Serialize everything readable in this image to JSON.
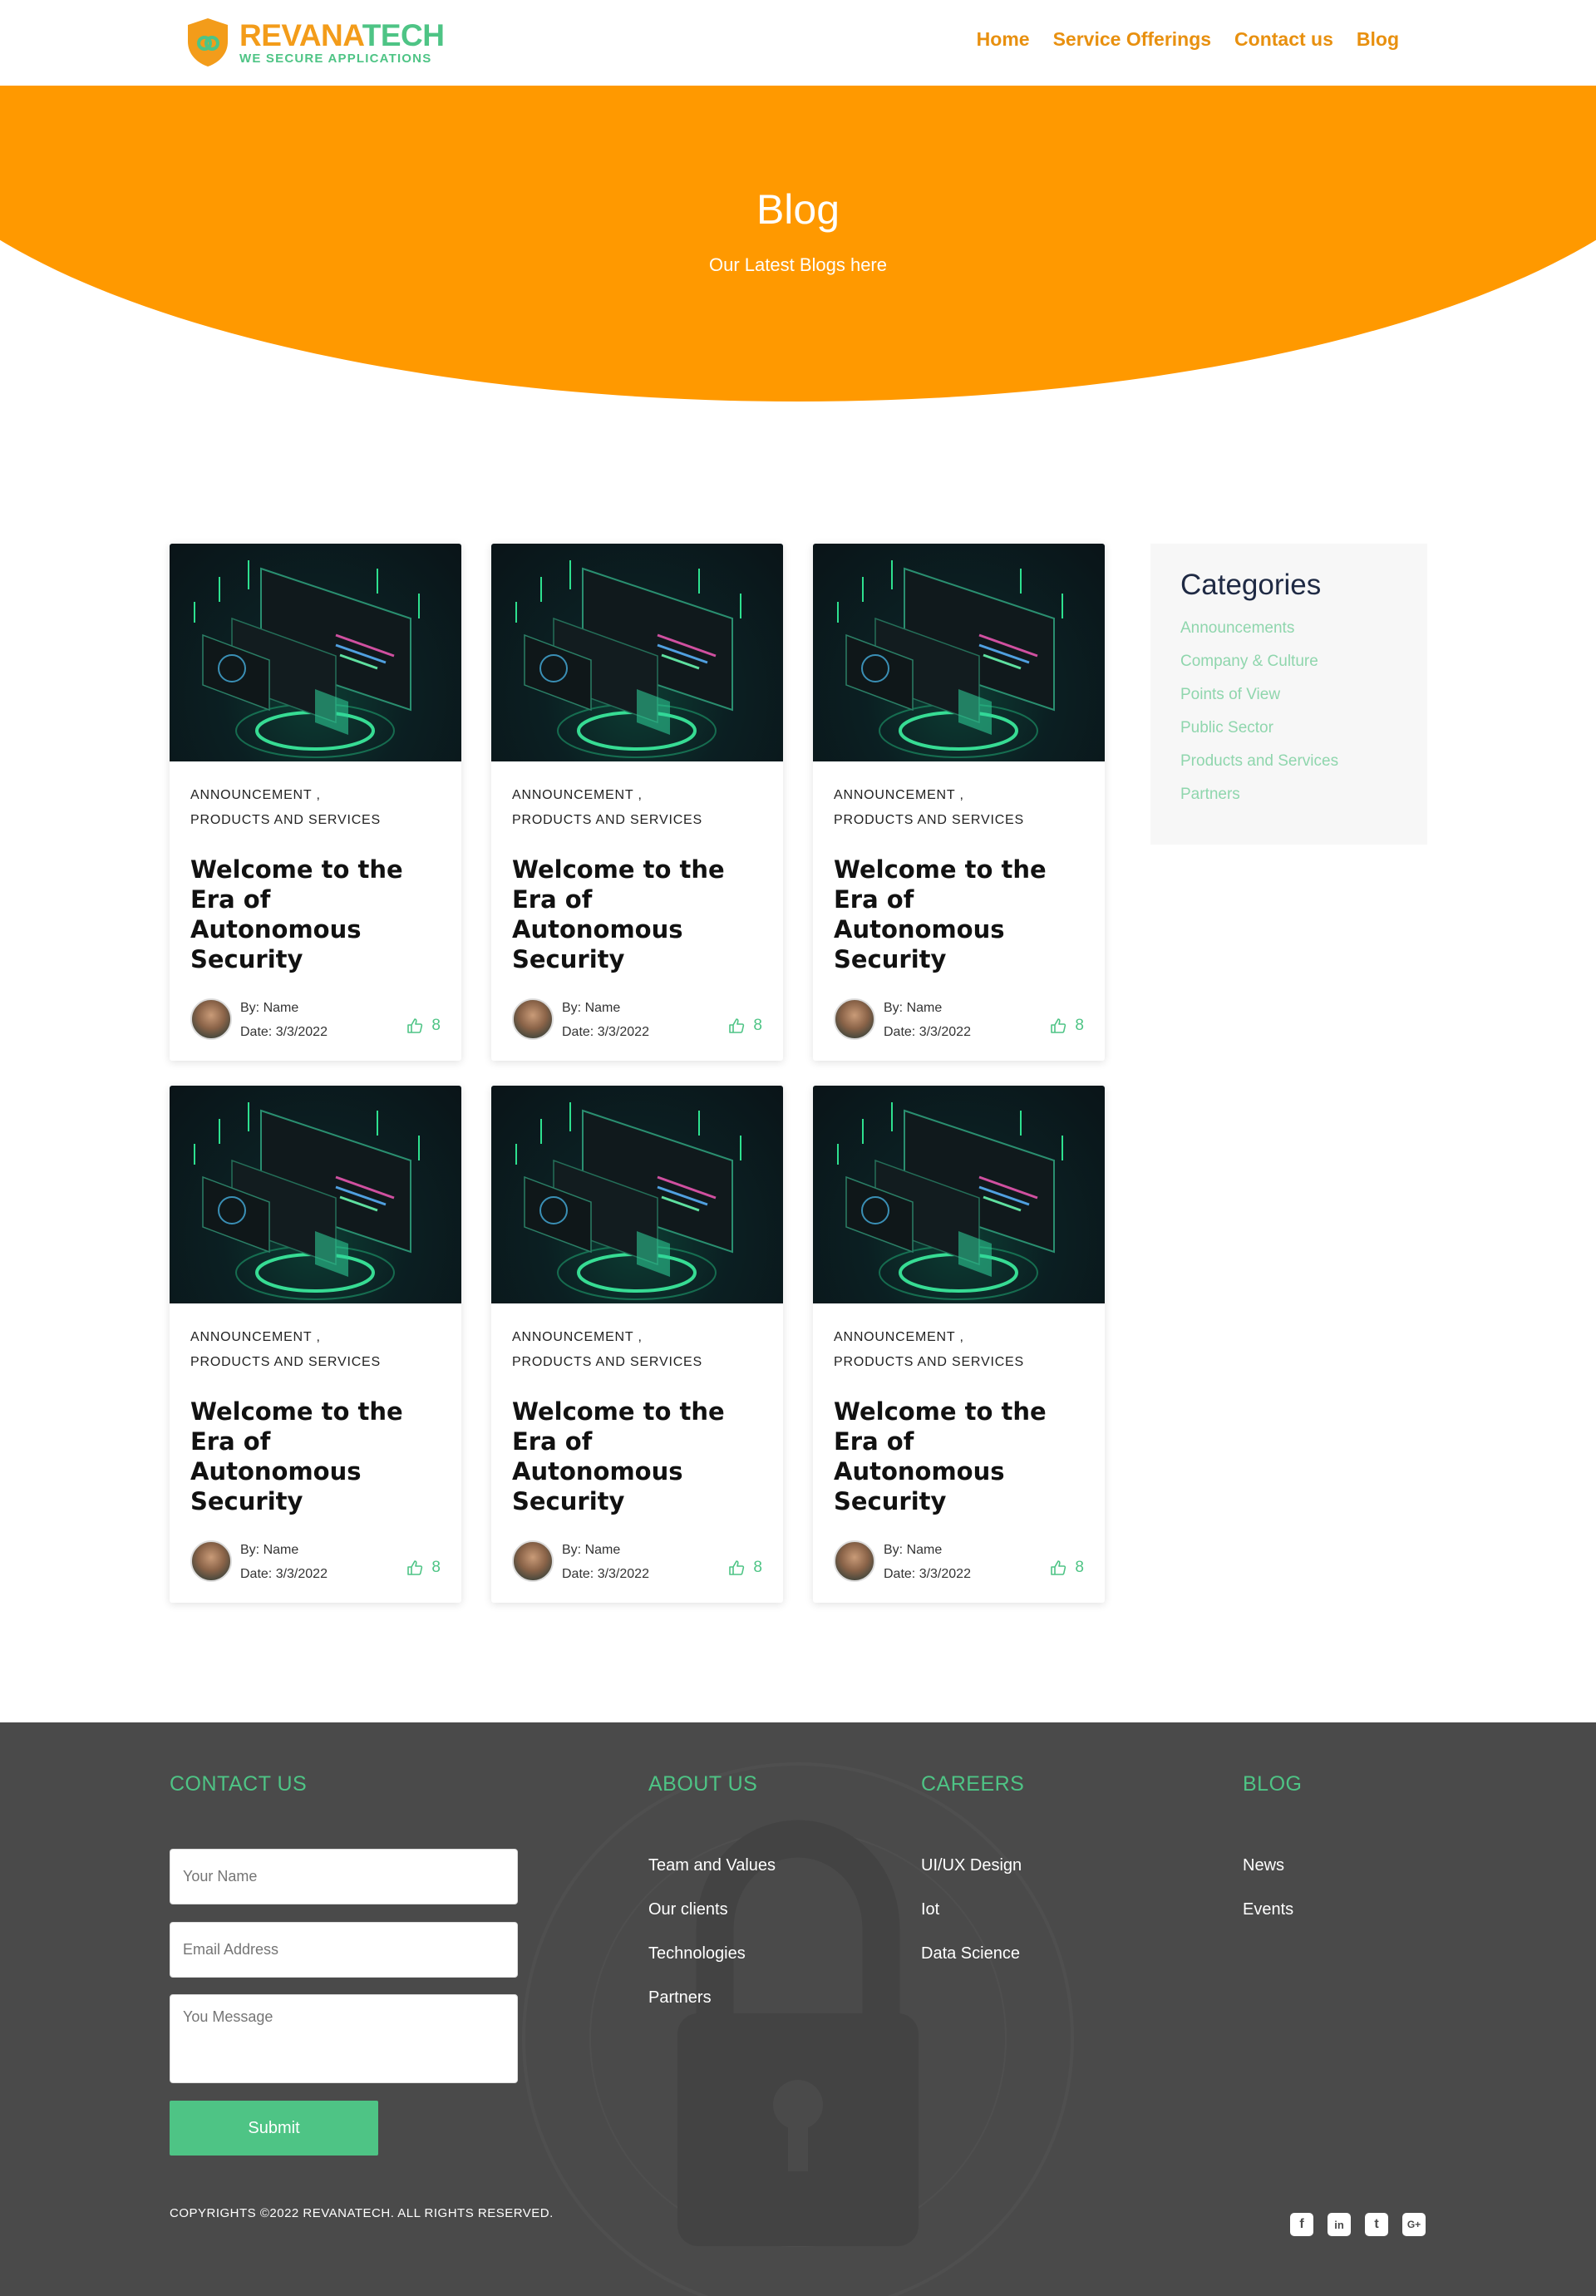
{
  "brand": {
    "name_part1": "REVANA",
    "name_part2": "TECH",
    "tagline": "WE SECURE APPLICATIONS",
    "primary_color": "#ff9900",
    "accent_color": "#4ec485"
  },
  "nav": {
    "items": [
      {
        "label": "Home"
      },
      {
        "label": "Service Offerings"
      },
      {
        "label": "Contact us"
      },
      {
        "label": "Blog"
      }
    ]
  },
  "hero": {
    "title": "Blog",
    "subtitle": "Our Latest Blogs here"
  },
  "posts": [
    {
      "cat1": "ANNOUNCEMENT ,",
      "cat2": "PRODUCTS AND SERVICES",
      "title": "Welcome to the Era of Autonomous Security",
      "author": "By: Name",
      "date": "Date: 3/3/2022",
      "likes": "8"
    },
    {
      "cat1": "ANNOUNCEMENT ,",
      "cat2": "PRODUCTS AND SERVICES",
      "title": "Welcome to the Era of Autonomous Security",
      "author": "By: Name",
      "date": "Date: 3/3/2022",
      "likes": "8"
    },
    {
      "cat1": "ANNOUNCEMENT ,",
      "cat2": "PRODUCTS AND SERVICES",
      "title": "Welcome to the Era of Autonomous Security",
      "author": "By: Name",
      "date": "Date: 3/3/2022",
      "likes": "8"
    },
    {
      "cat1": "ANNOUNCEMENT ,",
      "cat2": "PRODUCTS AND SERVICES",
      "title": "Welcome to the Era of Autonomous Security",
      "author": "By: Name",
      "date": "Date: 3/3/2022",
      "likes": "8"
    },
    {
      "cat1": "ANNOUNCEMENT ,",
      "cat2": "PRODUCTS AND SERVICES",
      "title": "Welcome to the Era of Autonomous Security",
      "author": "By: Name",
      "date": "Date: 3/3/2022",
      "likes": "8"
    },
    {
      "cat1": "ANNOUNCEMENT ,",
      "cat2": "PRODUCTS AND SERVICES",
      "title": "Welcome to the Era of Autonomous Security",
      "author": "By: Name",
      "date": "Date: 3/3/2022",
      "likes": "8"
    }
  ],
  "sidebar": {
    "title": "Categories",
    "items": [
      {
        "label": "Announcements"
      },
      {
        "label": "Company & Culture"
      },
      {
        "label": "Points of View"
      },
      {
        "label": "Public Sector"
      },
      {
        "label": "Products and Services"
      },
      {
        "label": "Partners"
      }
    ]
  },
  "footer": {
    "contact": {
      "heading": "CONTACT US",
      "name_placeholder": "Your Name",
      "email_placeholder": "Email Address",
      "message_placeholder": "You Message",
      "submit_label": "Submit"
    },
    "about": {
      "heading": "ABOUT US",
      "links": [
        {
          "label": "Team and Values"
        },
        {
          "label": "Our clients"
        },
        {
          "label": "Technologies"
        },
        {
          "label": "Partners"
        }
      ]
    },
    "careers": {
      "heading": "CAREERS",
      "links": [
        {
          "label": "UI/UX Design"
        },
        {
          "label": "Iot"
        },
        {
          "label": "Data Science"
        }
      ]
    },
    "blog": {
      "heading": "BLOG",
      "links": [
        {
          "label": "News"
        },
        {
          "label": "Events"
        }
      ]
    },
    "copyright": "COPYRIGHTS ©2022 REVANATECH. ALL RIGHTS RESERVED.",
    "social": [
      {
        "icon": "facebook-icon",
        "glyph": "f"
      },
      {
        "icon": "linkedin-icon",
        "glyph": "in"
      },
      {
        "icon": "twitter-icon",
        "glyph": "t"
      },
      {
        "icon": "google-plus-icon",
        "glyph": "G+"
      }
    ]
  }
}
